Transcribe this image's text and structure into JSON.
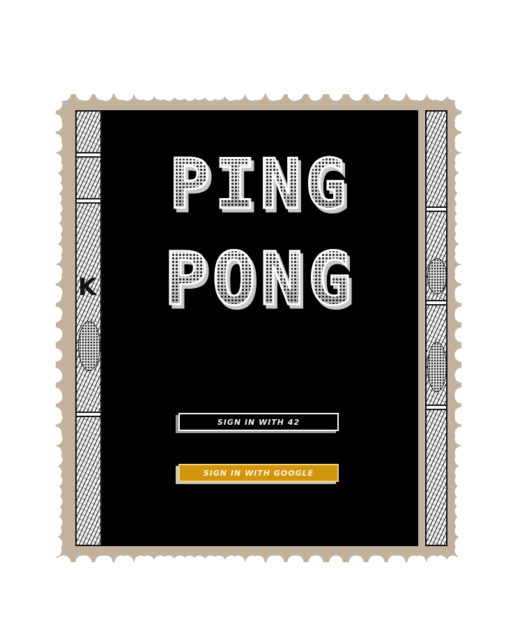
{
  "title": {
    "line1": "Ping",
    "line2": "Pong"
  },
  "buttons": {
    "sign_in_42": "SIGN IN WITH 42",
    "sign_in_google": "SIGN IN WITH GOOGLE"
  },
  "colors": {
    "stamp_border": "#c2b29d",
    "panel_background": "#000000",
    "google_button": "#d1960e"
  }
}
